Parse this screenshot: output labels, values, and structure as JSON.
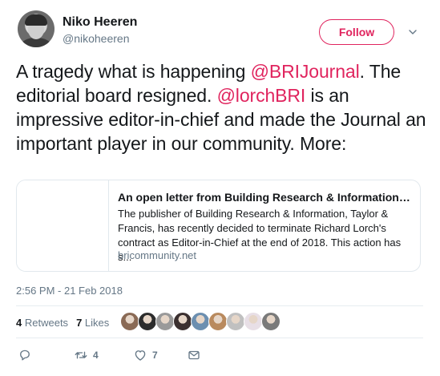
{
  "author": {
    "display_name": "Niko Heeren",
    "username": "@nikoheeren"
  },
  "follow_label": "Follow",
  "tweet": {
    "text_1": "A tragedy what is happening ",
    "mention_1": "@BRIJournal",
    "text_2": ". The editorial board resigned. ",
    "mention_2": "@lorchBRI",
    "text_3": " is an impressive editor-in-chief and made the Journal an important player in our community. More:"
  },
  "card": {
    "title": "An open letter from Building Research & Information EDITORIAL BOARD",
    "description": "The publisher of Building Research & Information, Taylor & Francis, has recently decided to terminate Richard Lorch's contract as Editor-in-Chief at the end of 2018. This action has s...",
    "domain": "bricommunity.net"
  },
  "timestamp": "2:56 PM - 21 Feb 2018",
  "stats": {
    "retweets_count": "4",
    "retweets_label": "Retweets",
    "likes_count": "7",
    "likes_label": "Likes"
  },
  "likers": [
    "#8a6a55",
    "#2d2d2d",
    "#9a9a9a",
    "#3b3030",
    "#6c8fb0",
    "#b98a5e",
    "#c0c0c0",
    "#e8dfe6",
    "#7a7a7a"
  ],
  "actions": {
    "reply_count": "",
    "retweet_count": "4",
    "like_count": "7"
  },
  "colors": {
    "accent": "#e0245e",
    "secondary_text": "#657786",
    "border": "#e1e8ed"
  }
}
